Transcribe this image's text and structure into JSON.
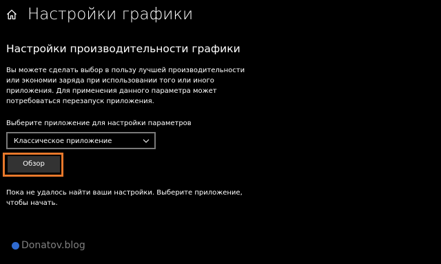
{
  "header": {
    "icon": "home-icon",
    "title": "Настройки графики"
  },
  "section": {
    "title": "Настройки производительности графики",
    "description": "Вы можете сделать выбор в пользу лучшей производительности или экономии заряда при использовании того или иного приложения. Для применения данного параметра может потребоваться перезапуск приложения."
  },
  "app_picker": {
    "label": "Выберите приложение для настройки параметров",
    "selected": "Классическое приложение",
    "browse_label": "Обзор"
  },
  "status": {
    "message": "Пока не удалось найти ваши настройки. Выберите приложение, чтобы начать."
  },
  "watermark": {
    "text": "Donatov.blog"
  },
  "colors": {
    "background": "#000000",
    "text": "#ffffff",
    "button_bg": "#333333",
    "select_border": "#7a7a7a",
    "highlight": "#e8782b",
    "watermark_dot": "#2f6ad0",
    "watermark_text": "#7f7f7f"
  }
}
